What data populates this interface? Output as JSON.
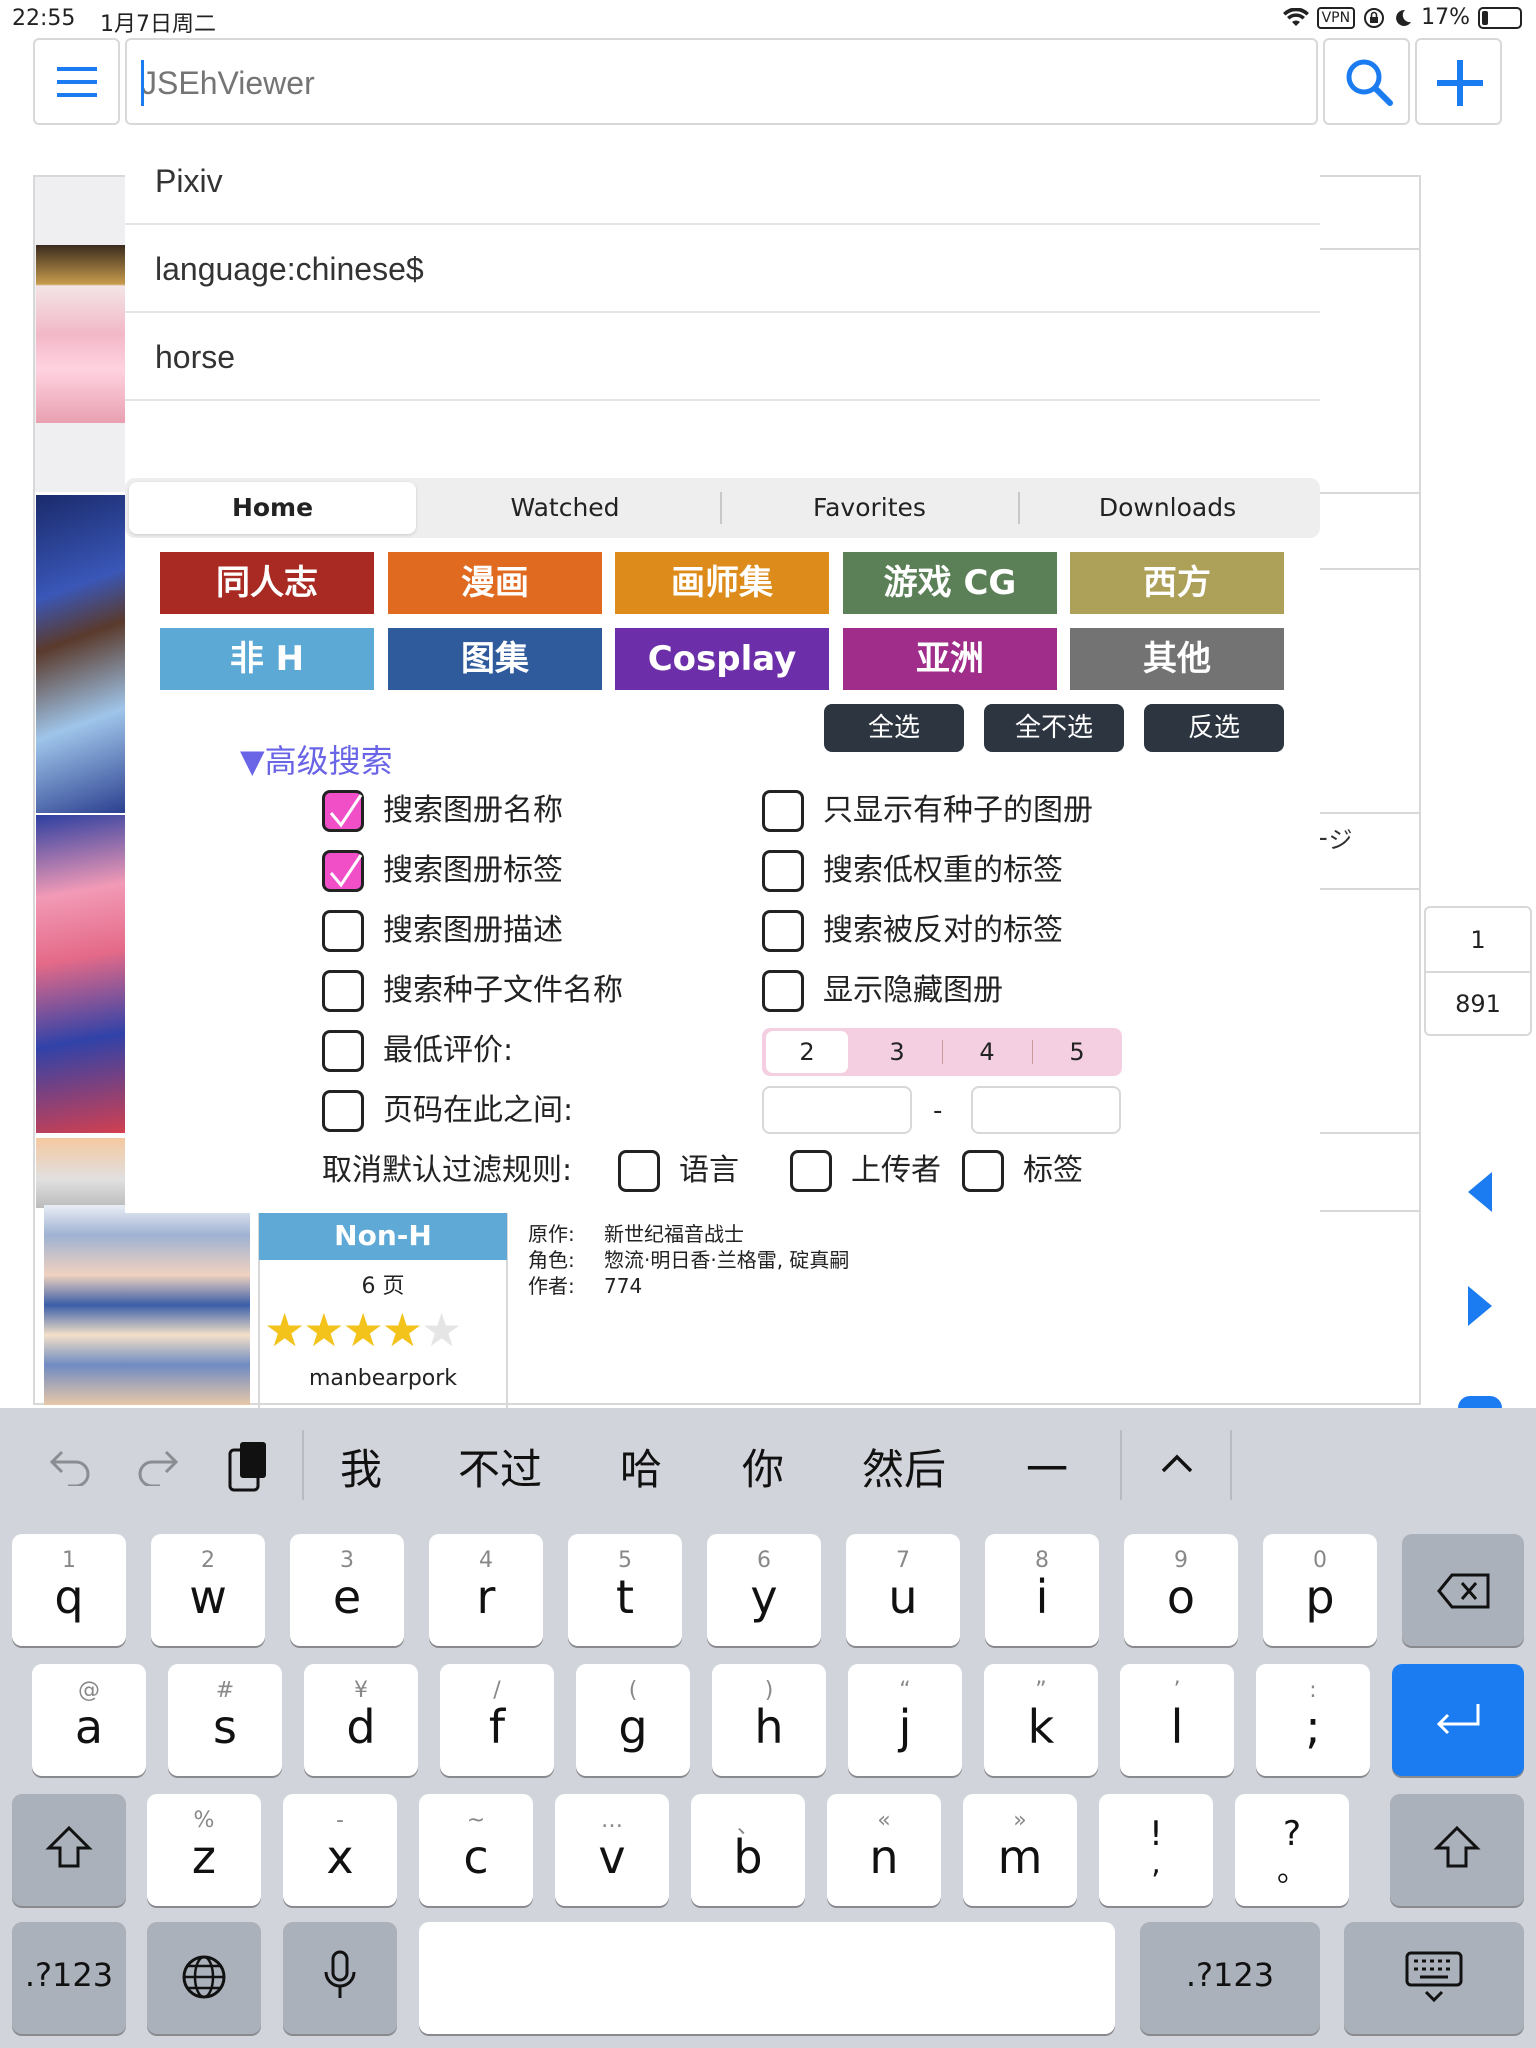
{
  "status": {
    "time": "22:55",
    "date": "1月7日周二",
    "vpn": "VPN",
    "battery": "17%"
  },
  "search": {
    "placeholder": "JSEhViewer"
  },
  "suggestions": [
    "Pixiv",
    "language:chinese$",
    "horse"
  ],
  "tabs": [
    "Home",
    "Watched",
    "Favorites",
    "Downloads"
  ],
  "categories": [
    {
      "label": "同人志",
      "color": "#a82a22"
    },
    {
      "label": "漫画",
      "color": "#e06a20"
    },
    {
      "label": "画师集",
      "color": "#dd8c1b"
    },
    {
      "label": "游戏 CG",
      "color": "#5b8058"
    },
    {
      "label": "西方",
      "color": "#ada058"
    },
    {
      "label": "非 H",
      "color": "#5ca9d5"
    },
    {
      "label": "图集",
      "color": "#2f5a9b"
    },
    {
      "label": "Cosplay",
      "color": "#6d2fa9"
    },
    {
      "label": "亚洲",
      "color": "#a02d8a"
    },
    {
      "label": "其他",
      "color": "#737373"
    }
  ],
  "select_buttons": [
    "全选",
    "全不选",
    "反选"
  ],
  "advanced": {
    "title": "▼高级搜索",
    "left_options": [
      {
        "label": "搜索图册名称",
        "checked": true
      },
      {
        "label": "搜索图册标签",
        "checked": true
      },
      {
        "label": "搜索图册描述",
        "checked": false
      },
      {
        "label": "搜索种子文件名称",
        "checked": false
      },
      {
        "label": "最低评价:",
        "checked": false
      },
      {
        "label": "页码在此之间:",
        "checked": false
      }
    ],
    "right_options": [
      {
        "label": "只显示有种子的图册",
        "checked": false
      },
      {
        "label": "搜索低权重的标签",
        "checked": false
      },
      {
        "label": "搜索被反对的标签",
        "checked": false
      },
      {
        "label": "显示隐藏图册",
        "checked": false
      }
    ],
    "rating": [
      "2",
      "3",
      "4",
      "5"
    ],
    "range_dash": "-",
    "filter_label": "取消默认过滤规则:",
    "filter_options": [
      "语言",
      "上传者",
      "标签"
    ]
  },
  "pager": {
    "current": "1",
    "total": "891"
  },
  "bg_text": "ージ",
  "gallery": {
    "category": "Non-H",
    "pages": "6 页",
    "rating": 4,
    "uploader": "manbearpork",
    "info": [
      {
        "k": "原作:",
        "v": "新世纪福音战士"
      },
      {
        "k": "角色:",
        "v": "惣流·明日香·兰格雷, 碇真嗣"
      },
      {
        "k": "作者:",
        "v": "774"
      }
    ]
  },
  "keyboard": {
    "candidates": [
      "我",
      "不过",
      "哈",
      "你",
      "然后",
      "一"
    ],
    "row1": [
      [
        "1",
        "q"
      ],
      [
        "2",
        "w"
      ],
      [
        "3",
        "e"
      ],
      [
        "4",
        "r"
      ],
      [
        "5",
        "t"
      ],
      [
        "6",
        "y"
      ],
      [
        "7",
        "u"
      ],
      [
        "8",
        "i"
      ],
      [
        "9",
        "o"
      ],
      [
        "0",
        "p"
      ]
    ],
    "row2": [
      [
        "@",
        "a"
      ],
      [
        "#",
        "s"
      ],
      [
        "¥",
        "d"
      ],
      [
        "/",
        "f"
      ],
      [
        "(",
        "g"
      ],
      [
        ")",
        "h"
      ],
      [
        "“",
        "j"
      ],
      [
        "”",
        "k"
      ],
      [
        "’",
        "l"
      ],
      [
        ":",
        ";"
      ]
    ],
    "row3": [
      [
        "%",
        "z"
      ],
      [
        "-",
        "x"
      ],
      [
        "~",
        "c"
      ],
      [
        "…",
        "v"
      ],
      [
        "、",
        "b"
      ],
      [
        "«",
        "n"
      ],
      [
        "»",
        "m"
      ],
      [
        "!",
        ","
      ],
      [
        "?",
        "。"
      ]
    ],
    "mode_label": ".?123"
  }
}
